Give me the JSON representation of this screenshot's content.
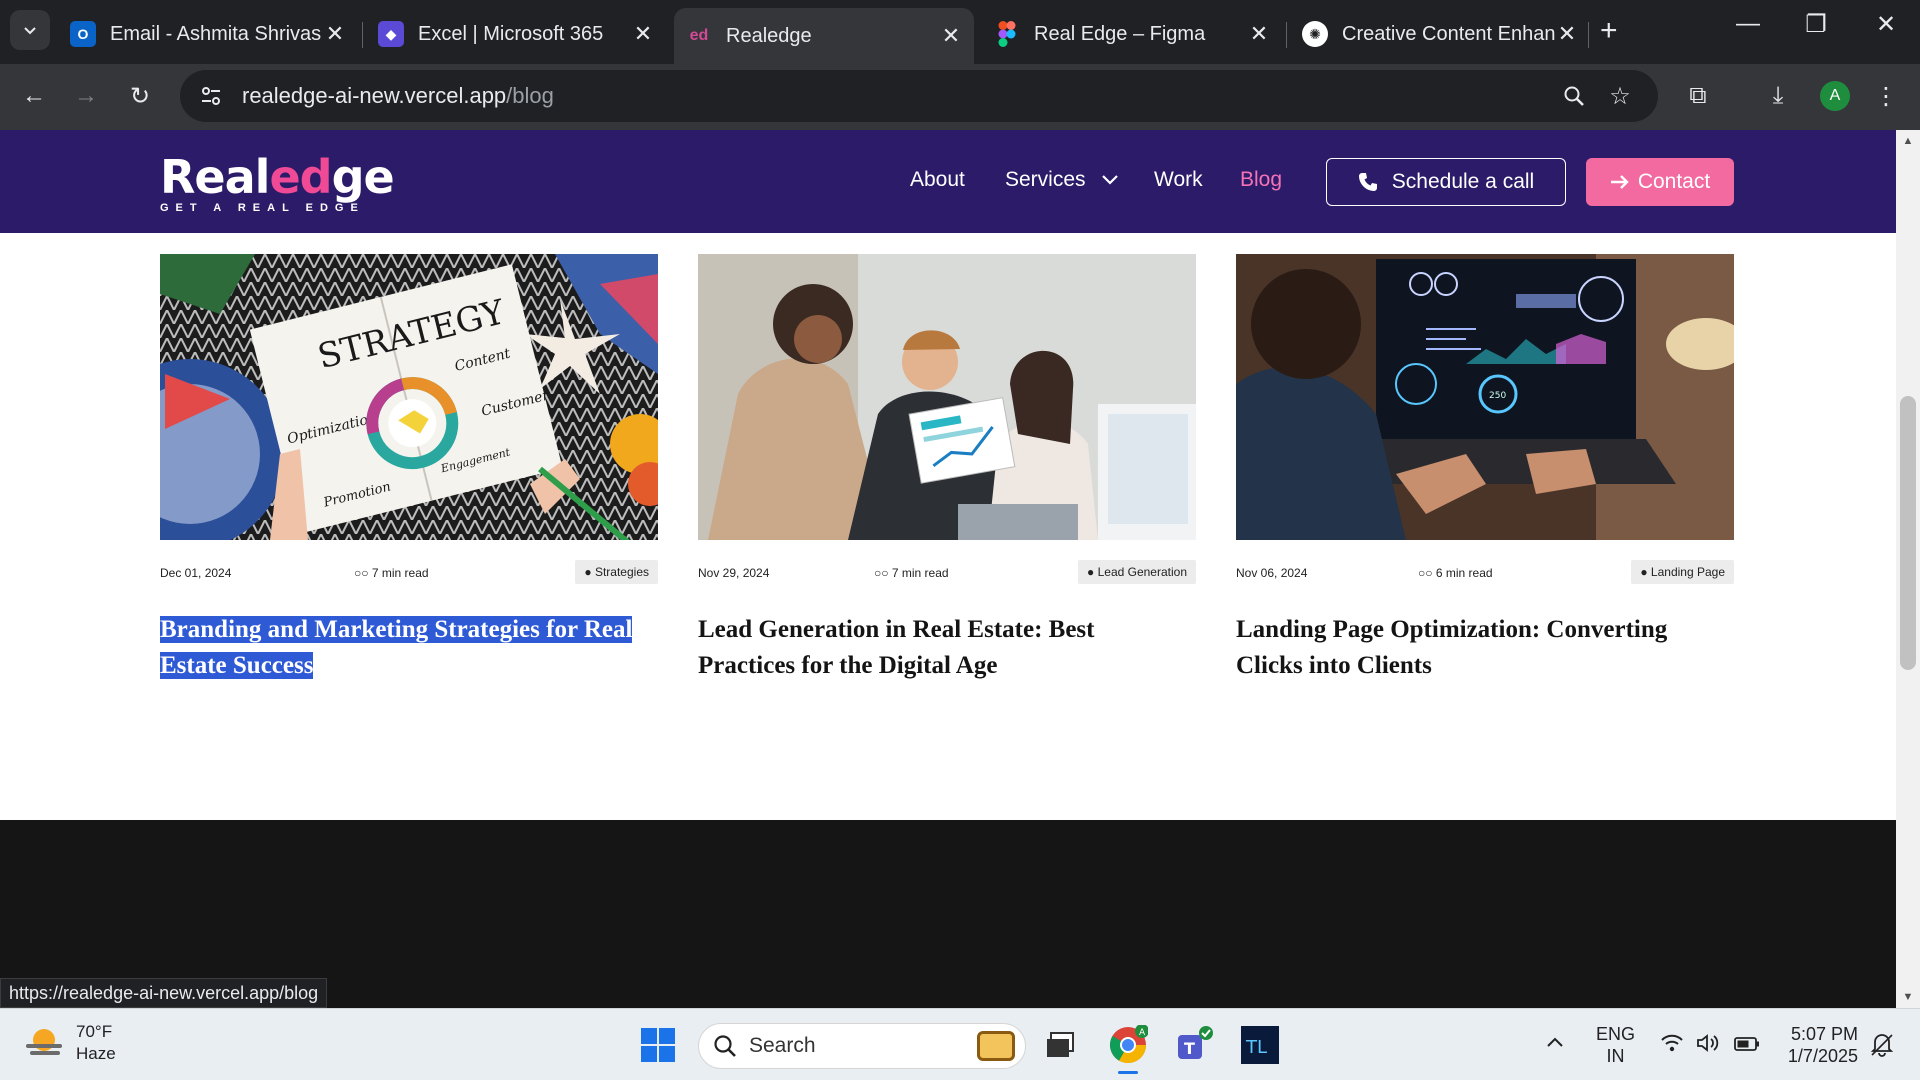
{
  "browser": {
    "tabs": [
      {
        "label": "Email - Ashmita Shrivas -",
        "active": false,
        "icon": "outlook-icon",
        "icon_color": "#0a64c8"
      },
      {
        "label": "Excel | Microsoft 365",
        "active": false,
        "icon": "m365-icon",
        "icon_color": "#5b4ad6"
      },
      {
        "label": "Realedge",
        "active": true,
        "icon": "realedge-icon",
        "icon_color": "#d04a96"
      },
      {
        "label": "Real Edge – Figma",
        "active": false,
        "icon": "figma-icon",
        "icon_color": "#f24e1e"
      },
      {
        "label": "Creative Content Enhanc",
        "active": false,
        "icon": "chatgpt-icon",
        "icon_color": "#ffffff"
      }
    ],
    "url_host": "realedge-ai-new.vercel.app",
    "url_path": "/blog",
    "profile_initial": "A",
    "status_url": "https://realedge-ai-new.vercel.app/blog"
  },
  "site": {
    "logo_left": "Real",
    "logo_mid": "ed",
    "logo_right": "ge",
    "tagline": "GET A REAL EDGE",
    "nav": [
      {
        "label": "About"
      },
      {
        "label": "Services"
      },
      {
        "label": "Work"
      },
      {
        "label": "Blog",
        "active": true
      }
    ],
    "schedule_label": "Schedule a call",
    "contact_label": "Contact",
    "accent": "#f26aa0",
    "nav_bg": "#2b1b68"
  },
  "posts": [
    {
      "date": "Dec 01, 2024",
      "read": "7 min read",
      "tag": "Strategies",
      "title_line1": "Branding and Marketing Strategies for Real",
      "title_line2": "Estate Success",
      "selected": true,
      "img_words": {
        "title": "STRATEGY",
        "w1": "Content",
        "w2": "Optimization",
        "w3": "Customer",
        "w4": "Promotion",
        "w5": "Engagement"
      }
    },
    {
      "date": "Nov 29, 2024",
      "read": "7 min read",
      "tag": "Lead Generation",
      "title_line1": "Lead Generation in Real Estate: Best",
      "title_line2": "Practices for the Digital Age",
      "selected": false
    },
    {
      "date": "Nov 06, 2024",
      "read": "6 min read",
      "tag": "Landing Page",
      "title_line1": "Landing Page Optimization: Converting",
      "title_line2": "Clicks into Clients",
      "selected": false,
      "img_number": "250"
    }
  ],
  "taskbar": {
    "temp": "70°F",
    "weather": "Haze",
    "search_placeholder": "Search",
    "lang1": "ENG",
    "lang2": "IN",
    "time": "5:07 PM",
    "date": "1/7/2025"
  }
}
